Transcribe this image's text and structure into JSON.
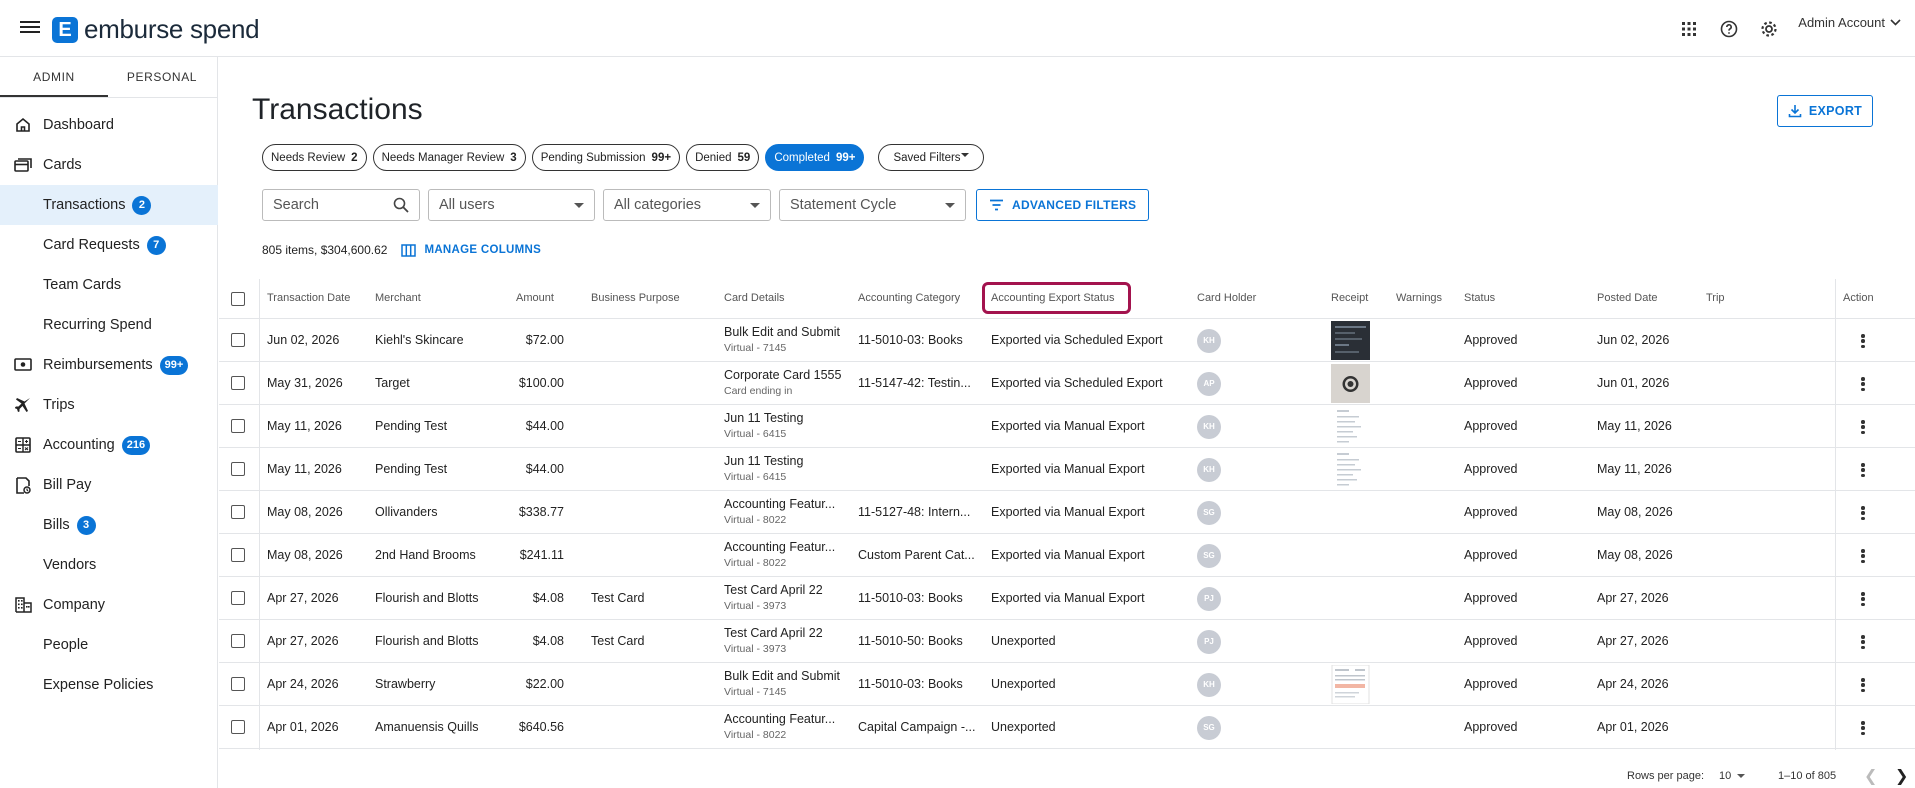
{
  "app": {
    "brand": "emburse spend",
    "brand_mark": "E"
  },
  "header": {
    "account_label": "Admin Account",
    "icons": [
      "apps-grid-icon",
      "help-icon",
      "settings-icon"
    ]
  },
  "sidebar": {
    "tabs": [
      "ADMIN",
      "PERSONAL"
    ],
    "items": [
      {
        "label": "Dashboard",
        "icon": "home-icon",
        "badge": null
      },
      {
        "label": "Cards",
        "icon": "card-icon",
        "badge": null
      },
      {
        "label": "Transactions",
        "icon": null,
        "badge": "2"
      },
      {
        "label": "Card Requests",
        "icon": null,
        "badge": "7"
      },
      {
        "label": "Team Cards",
        "icon": null,
        "badge": null
      },
      {
        "label": "Recurring Spend",
        "icon": null,
        "badge": null
      },
      {
        "label": "Reimbursements",
        "icon": "money-icon",
        "badge": "99+"
      },
      {
        "label": "Trips",
        "icon": "plane-icon",
        "badge": null
      },
      {
        "label": "Accounting",
        "icon": "calculator-icon",
        "badge": "216"
      },
      {
        "label": "Bill Pay",
        "icon": "bill-icon",
        "badge": null
      },
      {
        "label": "Bills",
        "icon": null,
        "badge": "3"
      },
      {
        "label": "Vendors",
        "icon": null,
        "badge": null
      },
      {
        "label": "Company",
        "icon": "building-icon",
        "badge": null
      },
      {
        "label": "People",
        "icon": null,
        "badge": null
      },
      {
        "label": "Expense Policies",
        "icon": null,
        "badge": null
      }
    ]
  },
  "main": {
    "title": "Transactions",
    "export_label": "EXPORT",
    "chips": [
      {
        "label": "Needs Review",
        "count": "2"
      },
      {
        "label": "Needs Manager Review",
        "count": "3"
      },
      {
        "label": "Pending Submission",
        "count": "99+"
      },
      {
        "label": "Denied",
        "count": "59"
      },
      {
        "label": "Completed",
        "count": "99+"
      }
    ],
    "saved_filters_label": "Saved Filters",
    "search_placeholder": "Search",
    "users_select": "All users",
    "categories_select": "All categories",
    "statement_select": "Statement Cycle",
    "advanced_filters_label": "ADVANCED FILTERS",
    "summary": "805 items, $304,600.62",
    "manage_columns_label": "MANAGE COLUMNS"
  },
  "table": {
    "columns": [
      "Transaction Date",
      "Merchant",
      "Amount",
      "Business Purpose",
      "Card Details",
      "Accounting Category",
      "Accounting Export Status",
      "Card Holder",
      "Receipt",
      "Warnings",
      "Status",
      "Posted Date",
      "Trip",
      "Action"
    ],
    "rows": [
      {
        "date": "Jun 02, 2026",
        "merchant": "Kiehl's Skincare",
        "amount": "$72.00",
        "purpose": "",
        "card": "Bulk Edit and Submit",
        "card_sub": "Virtual - 7145",
        "category": "11-5010-03: Books",
        "export": "Exported via Scheduled Export",
        "holder": "KH",
        "receipt": "dark",
        "status": "Approved",
        "posted": "Jun 02, 2026"
      },
      {
        "date": "May 31, 2026",
        "merchant": "Target",
        "amount": "$100.00",
        "purpose": "",
        "card": "Corporate Card 1555",
        "card_sub": "Card ending in",
        "category": "11-5147-42: Testin...",
        "export": "Exported via Scheduled Export",
        "holder": "AP",
        "receipt": "target",
        "status": "Approved",
        "posted": "Jun 01, 2026"
      },
      {
        "date": "May 11, 2026",
        "merchant": "Pending Test",
        "amount": "$44.00",
        "purpose": "",
        "card": "Jun 11 Testing",
        "card_sub": "Virtual - 6415",
        "category": "",
        "export": "Exported via Manual Export",
        "holder": "KH",
        "receipt": "doc",
        "status": "Approved",
        "posted": "May 11, 2026"
      },
      {
        "date": "May 11, 2026",
        "merchant": "Pending Test",
        "amount": "$44.00",
        "purpose": "",
        "card": "Jun 11 Testing",
        "card_sub": "Virtual - 6415",
        "category": "",
        "export": "Exported via Manual Export",
        "holder": "KH",
        "receipt": "doc",
        "status": "Approved",
        "posted": "May 11, 2026"
      },
      {
        "date": "May 08, 2026",
        "merchant": "Ollivanders",
        "amount": "$338.77",
        "purpose": "",
        "card": "Accounting Featur...",
        "card_sub": "Virtual - 8022",
        "category": "11-5127-48: Intern...",
        "export": "Exported via Manual Export",
        "holder": "SG",
        "receipt": "",
        "status": "Approved",
        "posted": "May 08, 2026"
      },
      {
        "date": "May 08, 2026",
        "merchant": "2nd Hand Brooms",
        "amount": "$241.11",
        "purpose": "",
        "card": "Accounting Featur...",
        "card_sub": "Virtual - 8022",
        "category": "Custom Parent Cat...",
        "export": "Exported via Manual Export",
        "holder": "SG",
        "receipt": "",
        "status": "Approved",
        "posted": "May 08, 2026"
      },
      {
        "date": "Apr 27, 2026",
        "merchant": "Flourish and Blotts",
        "amount": "$4.08",
        "purpose": "Test Card",
        "card": "Test Card April 22",
        "card_sub": "Virtual - 3973",
        "category": "11-5010-03: Books",
        "export": "Exported via Manual Export",
        "holder": "PJ",
        "receipt": "",
        "status": "Approved",
        "posted": "Apr 27, 2026"
      },
      {
        "date": "Apr 27, 2026",
        "merchant": "Flourish and Blotts",
        "amount": "$4.08",
        "purpose": "Test Card",
        "card": "Test Card April 22",
        "card_sub": "Virtual - 3973",
        "category": "11-5010-50: Books",
        "export": "Unexported",
        "holder": "PJ",
        "receipt": "",
        "status": "Approved",
        "posted": "Apr 27, 2026"
      },
      {
        "date": "Apr 24, 2026",
        "merchant": "Strawberry",
        "amount": "$22.00",
        "purpose": "",
        "card": "Bulk Edit and Submit",
        "card_sub": "Virtual - 7145",
        "category": "11-5010-03: Books",
        "export": "Unexported",
        "holder": "KH",
        "receipt": "invoice",
        "status": "Approved",
        "posted": "Apr 24, 2026"
      },
      {
        "date": "Apr 01, 2026",
        "merchant": "Amanuensis Quills",
        "amount": "$640.56",
        "purpose": "",
        "card": "Accounting Featur...",
        "card_sub": "Virtual - 8022",
        "category": "Capital Campaign -...",
        "export": "Unexported",
        "holder": "SG",
        "receipt": "",
        "status": "Approved",
        "posted": "Apr 01, 2026"
      }
    ]
  },
  "pager": {
    "rows_per_page_label": "Rows per page:",
    "rows_per_page": "10",
    "range": "1–10 of 805"
  },
  "colors": {
    "accent": "#0a74d6",
    "highlight": "#a3134e",
    "active_nav_bg": "#e4f0fb"
  }
}
